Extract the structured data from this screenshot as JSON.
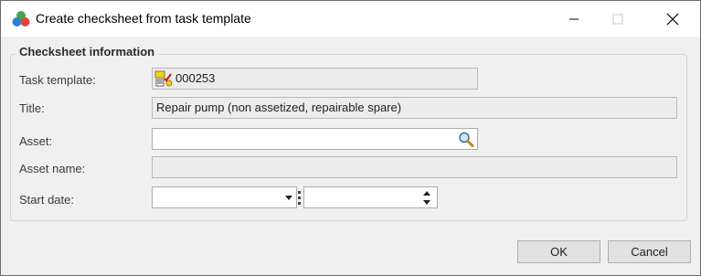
{
  "window": {
    "title": "Create checksheet from task template",
    "icon": "checksheet-balls-icon"
  },
  "group": {
    "legend": "Checksheet information"
  },
  "fields": {
    "task_template": {
      "label": "Task template:",
      "value": "000253",
      "icon": "task-template-icon"
    },
    "title": {
      "label": "Title:",
      "value": "Repair pump (non assetized, repairable spare)"
    },
    "asset": {
      "label": "Asset:",
      "value": "",
      "icon": "magnifier-search-icon"
    },
    "asset_name": {
      "label": "Asset name:",
      "value": ""
    },
    "start_date": {
      "label": "Start date:",
      "date_value": "",
      "time_value": ""
    }
  },
  "buttons": {
    "ok": "OK",
    "cancel": "Cancel"
  }
}
